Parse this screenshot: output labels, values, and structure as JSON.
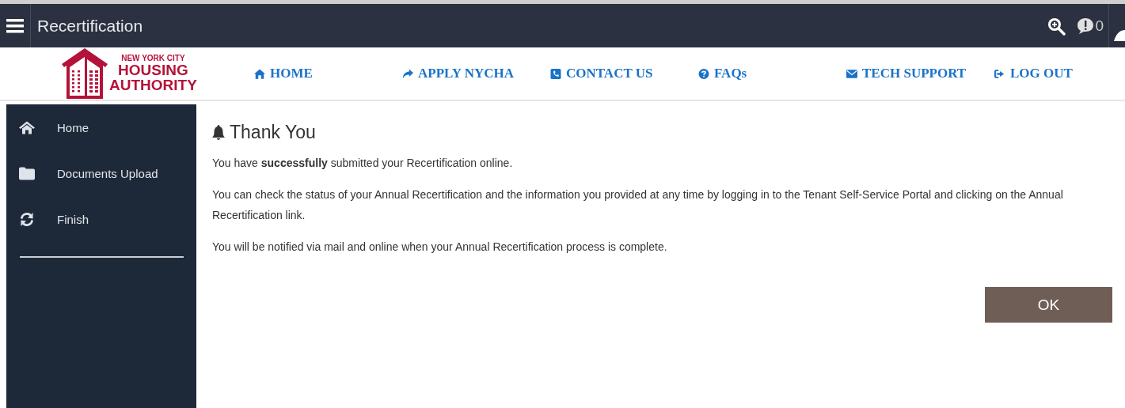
{
  "header": {
    "title": "Recertification",
    "notification_count": "0"
  },
  "logo": {
    "lines": [
      "NEW YORK CITY",
      "HOUSING",
      "AUTHORITY"
    ]
  },
  "nav": [
    {
      "kind": "home",
      "label": "HOME"
    },
    {
      "kind": "share",
      "label": "APPLY NYCHA"
    },
    {
      "kind": "phone",
      "label": "CONTACT US"
    },
    {
      "kind": "question",
      "label": "FAQs"
    },
    {
      "kind": "envelope",
      "label": "TECH SUPPORT"
    },
    {
      "kind": "logout",
      "label": "LOG OUT"
    }
  ],
  "sidebar": {
    "items": [
      {
        "kind": "home",
        "label": "Home"
      },
      {
        "kind": "folder",
        "label": "Documents Upload"
      },
      {
        "kind": "refresh",
        "label": "Finish"
      }
    ]
  },
  "content": {
    "title": "Thank You",
    "paragraphs": [
      "You have  **successfully** submitted your Recertification online.",
      "You can check the status of your Annual Recertification and the information you provided at any time by logging in to the Tenant Self-Service Portal and clicking on the Annual Recertification link.",
      "You will be notified via mail and online when your Annual Recertification process is complete."
    ],
    "button": "OK"
  }
}
